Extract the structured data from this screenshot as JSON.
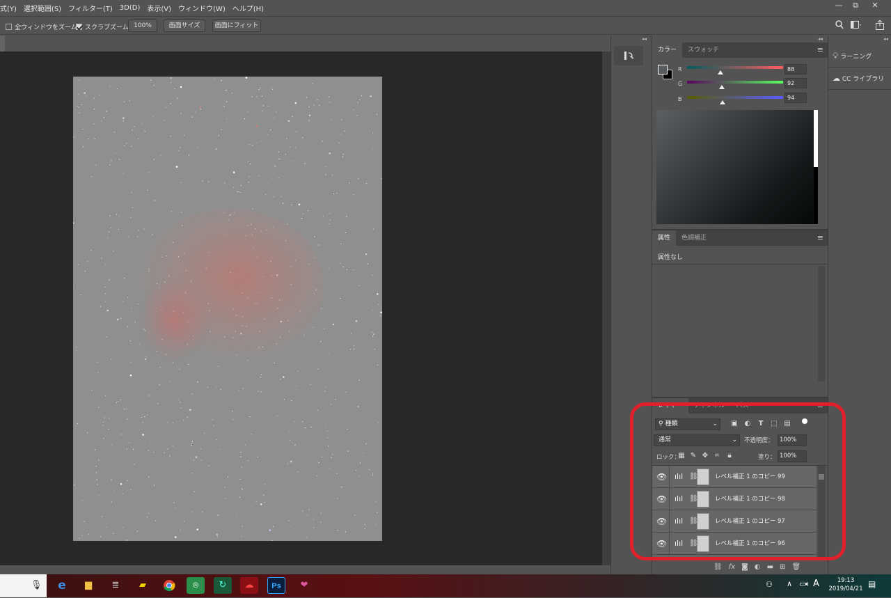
{
  "menubar": {
    "items": [
      "式(Y)",
      "選択範囲(S)",
      "フィルター(T)",
      "3D(D)",
      "表示(V)",
      "ウィンドウ(W)",
      "ヘルプ(H)"
    ]
  },
  "window_controls": {
    "minimize": "—",
    "restore": "⧉",
    "close": "✕"
  },
  "options_bar": {
    "zoom_all_windows_label": "全ウィンドウをズーム",
    "zoom_all_windows_checked": false,
    "scrubby_zoom_label": "スクラブズーム",
    "scrubby_zoom_checked": true,
    "zoom_value": "100%",
    "screen_size_button": "画面サイズ",
    "fit_screen_button": "画面にフィット"
  },
  "collapse_glyph": "◂◂",
  "color_panel": {
    "tabs": [
      "カラー",
      "スウォッチ"
    ],
    "active_tab": "カラー",
    "channels": [
      {
        "label": "R",
        "value": "88",
        "fraction": 0.345
      },
      {
        "label": "G",
        "value": "92",
        "fraction": 0.361
      },
      {
        "label": "B",
        "value": "94",
        "fraction": 0.369
      }
    ],
    "foreground_color": "#585c5e",
    "background_color": "#000000"
  },
  "properties_panel": {
    "tabs": [
      "属性",
      "色調補正"
    ],
    "active_tab": "属性",
    "message": "属性なし"
  },
  "layers_panel": {
    "tabs": [
      "レイヤー",
      "チャンネル",
      "パス"
    ],
    "filter_kind": "種類",
    "blend_mode": "通常",
    "opacity_label": "不透明度：",
    "opacity_value": "100%",
    "lock_label": "ロック：",
    "fill_label": "塗り：",
    "fill_value": "100%",
    "layers": [
      {
        "name": "レベル補正 1 のコピー 99",
        "visible": true
      },
      {
        "name": "レベル補正 1 のコピー 98",
        "visible": true
      },
      {
        "name": "レベル補正 1 のコピー 97",
        "visible": true
      },
      {
        "name": "レベル補正 1 のコピー 96",
        "visible": true
      }
    ],
    "footer_icons": [
      "link-icon",
      "fx-icon",
      "mask-icon",
      "adjustment-icon",
      "folder-icon",
      "new-layer-icon",
      "trash-icon"
    ]
  },
  "right_dock": {
    "items": [
      "ラーニング",
      "CC ライブラリ"
    ]
  },
  "taskbar": {
    "time": "19:13",
    "date": "2019/04/21",
    "ime": "A",
    "ps_label": "Ps"
  },
  "colors": {
    "highlight": "#e0202a",
    "panel_bg": "#535353",
    "canvas_bg": "#282828"
  }
}
